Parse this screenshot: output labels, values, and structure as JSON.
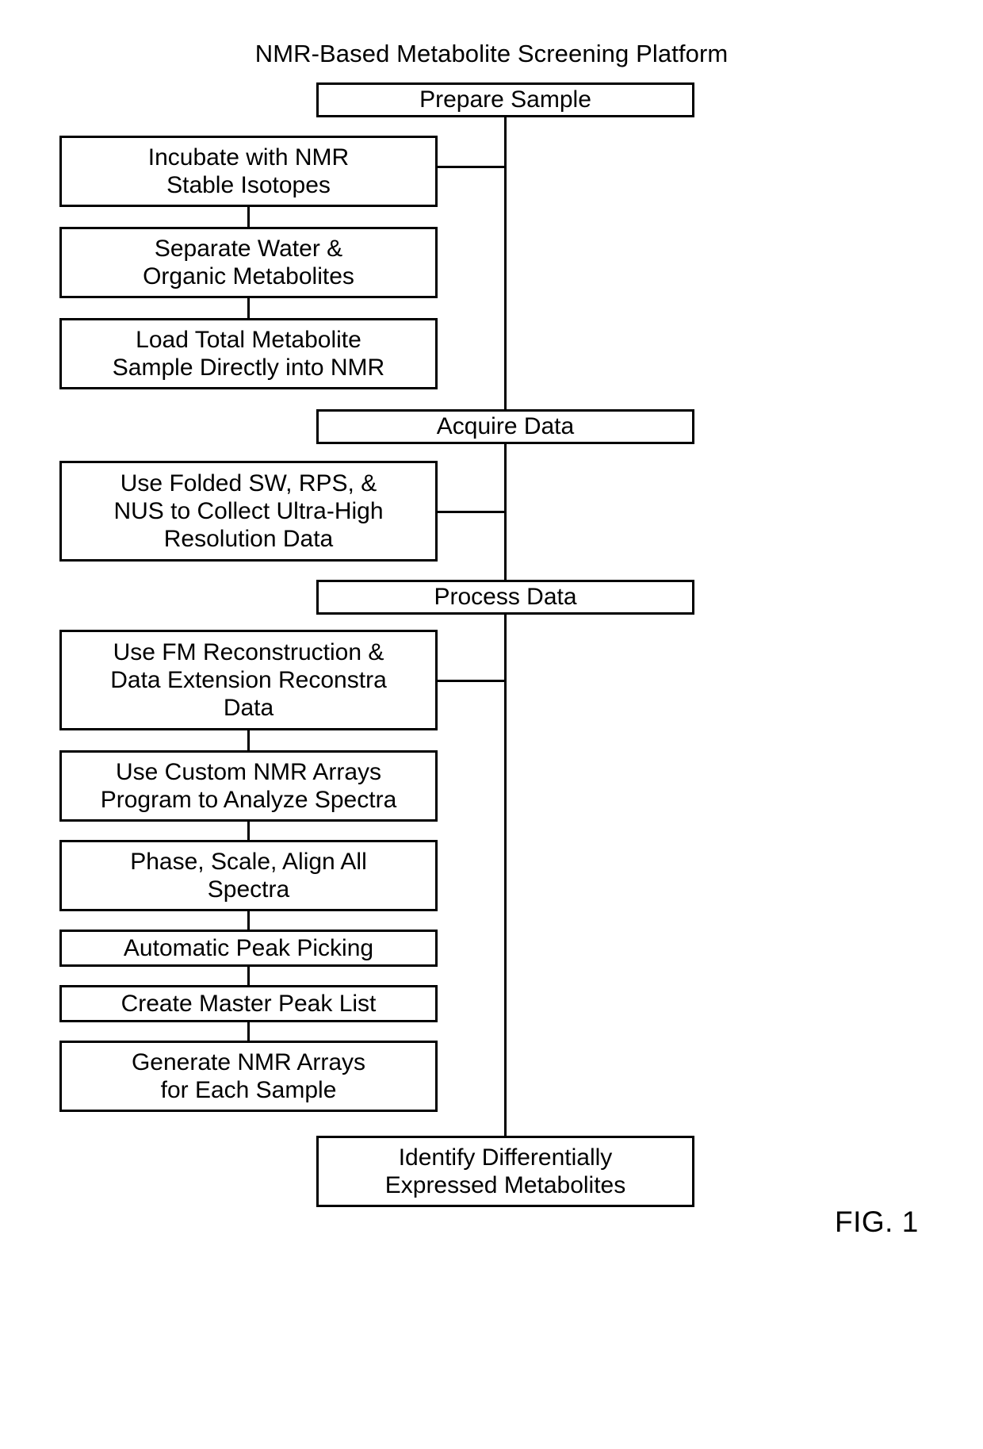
{
  "figure": {
    "title": "NMR-Based Metabolite Screening Platform",
    "caption": "FIG. 1"
  },
  "stages": {
    "prepare_sample": "Prepare Sample",
    "acquire_data": "Acquire Data",
    "process_data": "Process Data",
    "identify_metabolites_line1": "Identify Differentially",
    "identify_metabolites_line2": "Expressed Metabolites"
  },
  "prepare_steps": [
    {
      "line1": "Incubate with NMR",
      "line2": "Stable Isotopes"
    },
    {
      "line1": "Separate Water &",
      "line2": "Organic Metabolites"
    },
    {
      "line1": "Load Total Metabolite",
      "line2": "Sample Directly into NMR"
    }
  ],
  "acquire_steps": [
    {
      "line1": "Use Folded SW, RPS, &",
      "line2": "NUS to Collect Ultra-High",
      "line3": "Resolution Data"
    }
  ],
  "process_steps": [
    {
      "line1": "Use FM Reconstruction &",
      "line2": "Data Extension Reconstra",
      "line3": "Data"
    },
    {
      "line1": "Use Custom NMR Arrays",
      "line2": "Program to Analyze Spectra"
    },
    {
      "line1": "Phase, Scale, Align All",
      "line2": "Spectra"
    },
    {
      "line1": "Automatic Peak Picking"
    },
    {
      "line1": "Create Master Peak List"
    },
    {
      "line1": "Generate NMR Arrays",
      "line2": "for Each Sample"
    }
  ],
  "colors": {
    "stroke": "#000000",
    "background": "#ffffff",
    "text": "#000000"
  }
}
